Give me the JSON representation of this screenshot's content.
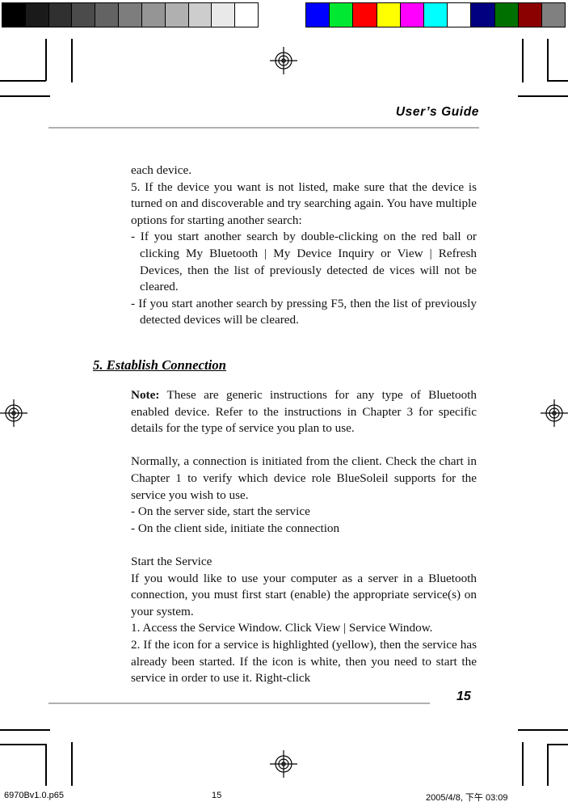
{
  "calibration": {
    "gray_bar": {
      "name": "grayscale-calibration-bar",
      "swatches": [
        "#000000",
        "#1a1a1a",
        "#303030",
        "#4b4b4b",
        "#636363",
        "#7d7d7d",
        "#959595",
        "#b0b0b0",
        "#cdcdcd",
        "#e9e9e9",
        "#ffffff"
      ]
    },
    "color_bar": {
      "name": "color-calibration-bar",
      "swatches": [
        "#0000ff",
        "#00e832",
        "#fe0000",
        "#ffff00",
        "#ff00ff",
        "#00ffff",
        "#ffffff",
        "#000080",
        "#007000",
        "#8b0000",
        "#808080"
      ]
    }
  },
  "header": {
    "title": "User’s Guide"
  },
  "body": {
    "block1": [
      "each device.",
      "5. If the device you want is not listed, make sure that the device is turned on and discoverable and try searching again. You have multiple options for starting another search:"
    ],
    "bullets1": [
      "- If you start another search by double-clicking on the red ball or clicking My Bluetooth | My Device Inquiry or View | Refresh Devices, then the list of previously detected de vices will not be cleared.",
      "- If you start another search by pressing F5, then the list of previously detected devices will be cleared."
    ],
    "section_heading": "5. Establish Connection",
    "note_label": "Note:",
    "note_text": " These are generic instructions for any type of Bluetooth enabled device. Refer to the instructions in Chapter 3 for specific details for the type of service you plan to use.",
    "block2": "Normally, a connection is initiated from the client. Check the chart in Chapter 1 to verify which device role BlueSoleil supports for the service you wish to use.",
    "bullets2": [
      "- On the server side, start the service",
      "- On the client side, initiate the connection"
    ],
    "subheading": "Start the Service",
    "block3": "If you would like to use your computer as a server in a Bluetooth connection, you must first start (enable) the appropriate service(s) on your system.",
    "block4": "1. Access the Service Window. Click View | Service Window.",
    "block5": "2. If the icon for a service is highlighted (yellow), then the service has already been started. If the icon is white, then you need to start the service in order to use it. Right-click"
  },
  "footer": {
    "page_number": "15"
  },
  "status_bar": {
    "file_name": "6970Bv1.0.p65",
    "page": "15",
    "timestamp": "2005/4/8, 下午 03:09"
  }
}
